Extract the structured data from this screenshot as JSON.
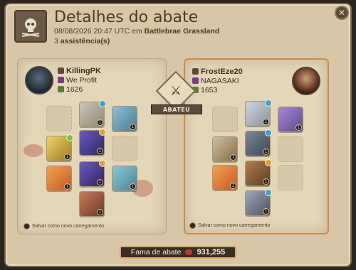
{
  "header": {
    "title": "Detalhes do abate",
    "timestamp": "08/08/2026 20:47 UTC em",
    "location": "Battlebrae Grassland",
    "assists_count": "3",
    "assists_label": "assistência(s)"
  },
  "buttons": {
    "close_glyph": "✕"
  },
  "center": {
    "label": "ABATEU"
  },
  "left_player": {
    "name": "KillingPK",
    "guild": "We Profit",
    "item_power": "1626",
    "save_label": "Salvar como novo carregamento"
  },
  "right_player": {
    "name": "FrostEze20",
    "guild": "NAGASAKI",
    "item_power": "1653",
    "save_label": "Salvar como novo carregamento"
  },
  "fame": {
    "label": "Fama de abate",
    "value": "931,255"
  },
  "colors": {
    "accent_gold": "#d7a95c",
    "fame_gem": "#b33a2e",
    "blood": "#aa3c28"
  }
}
